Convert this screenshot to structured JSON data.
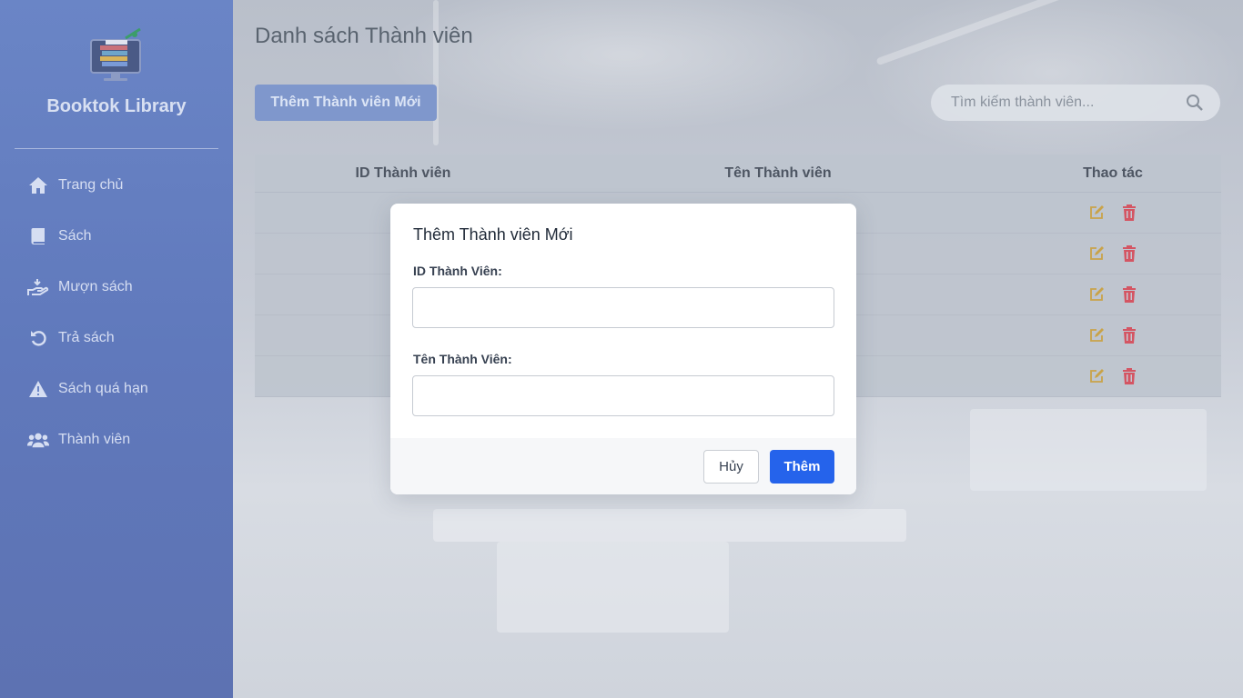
{
  "sidebar": {
    "brand": "Booktok Library",
    "items": [
      {
        "label": "Trang chủ",
        "icon": "home-icon"
      },
      {
        "label": "Sách",
        "icon": "book-icon"
      },
      {
        "label": "Mượn sách",
        "icon": "hand-give-icon"
      },
      {
        "label": "Trả sách",
        "icon": "undo-icon"
      },
      {
        "label": "Sách quá hạn",
        "icon": "warning-icon"
      },
      {
        "label": "Thành viên",
        "icon": "users-icon"
      }
    ]
  },
  "main": {
    "title": "Danh sách Thành viên",
    "add_button": "Thêm Thành viên Mới",
    "search": {
      "placeholder": "Tìm kiếm thành viên..."
    },
    "table": {
      "headers": [
        "ID Thành viên",
        "Tên Thành viên",
        "Thao tác"
      ],
      "row_count": 5
    }
  },
  "modal": {
    "title": "Thêm Thành viên Mới",
    "id_label": "ID Thành Viên:",
    "id_value": "",
    "name_label": "Tên Thành Viên:",
    "name_value": "",
    "cancel": "Hủy",
    "submit": "Thêm"
  },
  "colors": {
    "sidebar": "#6a85c6",
    "primary": "#2563eb",
    "edit_icon": "#c9a349",
    "delete_icon": "#d45563"
  }
}
